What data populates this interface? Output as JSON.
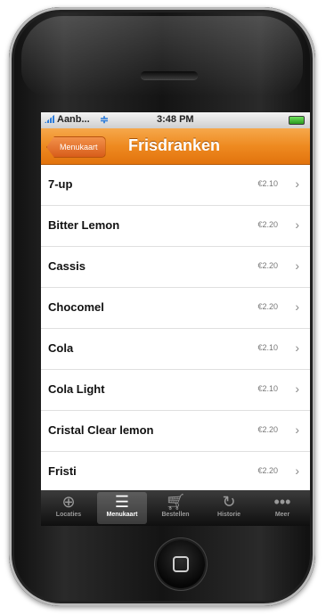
{
  "statusbar": {
    "carrier": "Aanb...",
    "time": "3:48 PM"
  },
  "navbar": {
    "back_label": "Menukaart",
    "title": "Frisdranken"
  },
  "items": [
    {
      "name": "7-up",
      "price": "€2.10"
    },
    {
      "name": "Bitter Lemon",
      "price": "€2.20"
    },
    {
      "name": "Cassis",
      "price": "€2.20"
    },
    {
      "name": "Chocomel",
      "price": "€2.20"
    },
    {
      "name": "Cola",
      "price": "€2.10"
    },
    {
      "name": "Cola Light",
      "price": "€2.10"
    },
    {
      "name": "Cristal Clear lemon",
      "price": "€2.20"
    },
    {
      "name": "Fristi",
      "price": "€2.20"
    }
  ],
  "tabbar": [
    {
      "label": "Locaties",
      "icon": "target-icon"
    },
    {
      "label": "Menukaart",
      "icon": "menu-icon"
    },
    {
      "label": "Bestellen",
      "icon": "cart-icon"
    },
    {
      "label": "Historie",
      "icon": "history-icon"
    },
    {
      "label": "Meer",
      "icon": "more-icon"
    }
  ],
  "colors": {
    "nav_orange": "#ee8a20",
    "tab_dark": "#0f0f0f"
  }
}
